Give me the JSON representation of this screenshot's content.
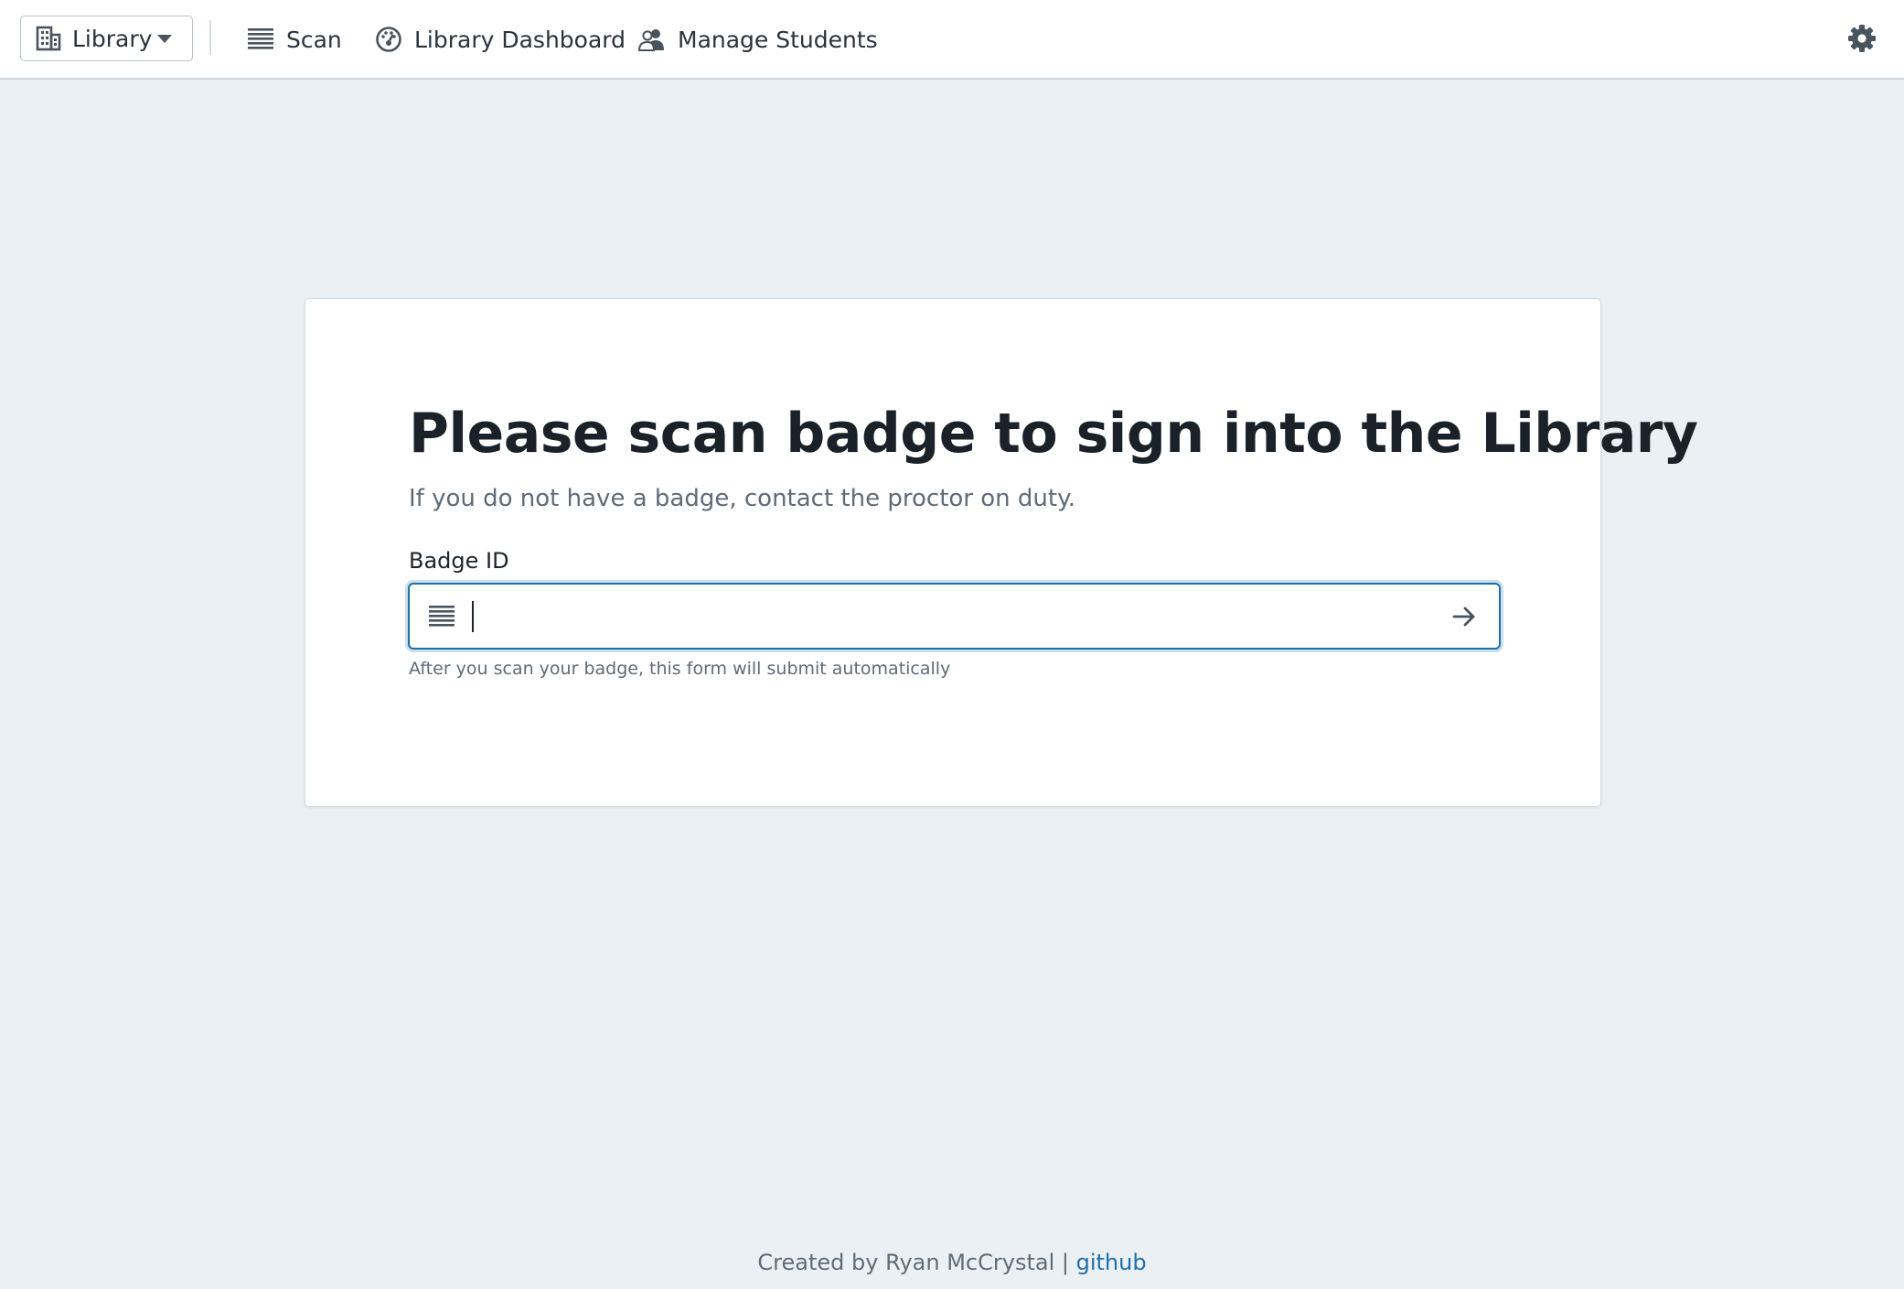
{
  "navbar": {
    "location_label": "Library",
    "items": [
      {
        "label": "Scan",
        "icon": "barcode-icon"
      },
      {
        "label": "Library Dashboard",
        "icon": "gauge-icon"
      },
      {
        "label": "Manage Students",
        "icon": "users-icon"
      }
    ],
    "settings_icon": "gear-icon"
  },
  "main": {
    "title": "Please scan badge to sign into the Library",
    "subtitle": "If you do not have a badge, contact the proctor on duty.",
    "badge_field": {
      "label": "Badge ID",
      "value": "",
      "placeholder": "",
      "help": "After you scan your badge, this form will submit automatically"
    }
  },
  "footer": {
    "text": "Created by Ryan McCrystal |",
    "link_label": "github"
  },
  "colors": {
    "accent": "#1f6fa8",
    "background": "#ebf0f4",
    "text_muted": "#5f6b77"
  }
}
